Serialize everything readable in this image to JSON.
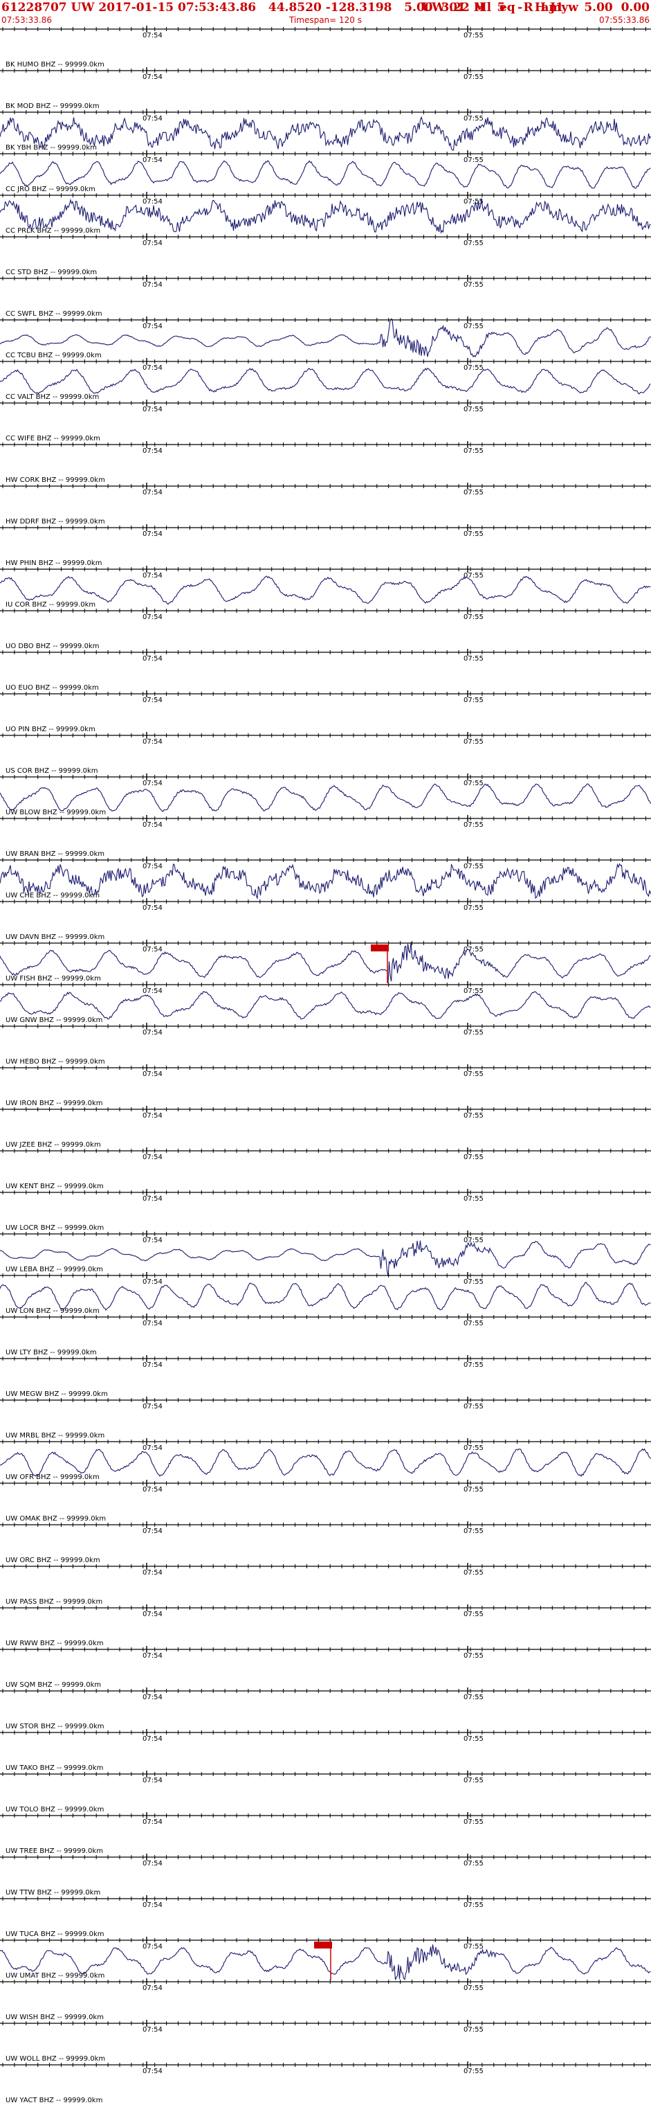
{
  "header": {
    "title": "61228707 UW 2017-01-15 07:53:43.86   44.8520 -128.3198   5.00  3.22 Ml  eq  R  amyw",
    "channel_info": "UW 01  H   5   -   H J1     5.00  0.00",
    "start_time": "07:53:33.86",
    "timespan": "Timespan= 120 s",
    "end_time": "07:55:33.86"
  },
  "time_marks": {
    "first": "07:54",
    "second": "07:55"
  },
  "colors": {
    "title": "#cc0000",
    "trace": "#1a1a6e",
    "axis": "#000000",
    "pick": "#cc0000"
  },
  "stations": [
    {
      "label": "BK HUMO BHZ -- 99999.0km",
      "trace": "none"
    },
    {
      "label": "BK MOD BHZ -- 99999.0km",
      "trace": "none"
    },
    {
      "label": "BK YBH BHZ -- 99999.0km",
      "trace": "noisy"
    },
    {
      "label": "CC JRO BHZ -- 99999.0km",
      "trace": "wave"
    },
    {
      "label": "CC PRLK BHZ -- 99999.0km",
      "trace": "noisy"
    },
    {
      "label": "CC STD BHZ -- 99999.0km",
      "trace": "none"
    },
    {
      "label": "CC SWFL BHZ -- 99999.0km",
      "trace": "none"
    },
    {
      "label": "CC TCBU BHZ -- 99999.0km",
      "trace": "burst"
    },
    {
      "label": "CC VALT BHZ -- 99999.0km",
      "trace": "wave"
    },
    {
      "label": "CC WIFE BHZ -- 99999.0km",
      "trace": "none"
    },
    {
      "label": "HW CORK BHZ -- 99999.0km",
      "trace": "none"
    },
    {
      "label": "HW DDRF BHZ -- 99999.0km",
      "trace": "none"
    },
    {
      "label": "HW PHIN BHZ -- 99999.0km",
      "trace": "none"
    },
    {
      "label": "IU COR BHZ -- 99999.0km",
      "trace": "wave"
    },
    {
      "label": "UO DBO BHZ -- 99999.0km",
      "trace": "none"
    },
    {
      "label": "UO EUO BHZ -- 99999.0km",
      "trace": "none"
    },
    {
      "label": "UO PIN BHZ -- 99999.0km",
      "trace": "none"
    },
    {
      "label": "US COR BHZ -- 99999.0km",
      "trace": "none"
    },
    {
      "label": "UW BLOW BHZ -- 99999.0km",
      "trace": "wave"
    },
    {
      "label": "UW BRAN BHZ -- 99999.0km",
      "trace": "none"
    },
    {
      "label": "UW CHE BHZ -- 99999.0km",
      "trace": "noisy"
    },
    {
      "label": "UW DAVN BHZ -- 99999.0km",
      "trace": "none"
    },
    {
      "label": "UW FISH BHZ -- 99999.0km",
      "trace": "pick"
    },
    {
      "label": "UW GNW BHZ -- 99999.0km",
      "trace": "wave"
    },
    {
      "label": "UW HEBO BHZ -- 99999.0km",
      "trace": "none"
    },
    {
      "label": "UW IRON BHZ -- 99999.0km",
      "trace": "none"
    },
    {
      "label": "UW JZEE BHZ -- 99999.0km",
      "trace": "none"
    },
    {
      "label": "UW KENT BHZ -- 99999.0km",
      "trace": "none"
    },
    {
      "label": "UW LOCR BHZ -- 99999.0km",
      "trace": "none"
    },
    {
      "label": "UW LEBA BHZ -- 99999.0km",
      "trace": "burst"
    },
    {
      "label": "UW LON BHZ -- 99999.0km",
      "trace": "wave"
    },
    {
      "label": "UW LTY BHZ -- 99999.0km",
      "trace": "none"
    },
    {
      "label": "UW MEGW BHZ -- 99999.0km",
      "trace": "none"
    },
    {
      "label": "UW MRBL BHZ -- 99999.0km",
      "trace": "none"
    },
    {
      "label": "UW OFR BHZ -- 99999.0km",
      "trace": "wave"
    },
    {
      "label": "UW OMAK BHZ -- 99999.0km",
      "trace": "none"
    },
    {
      "label": "UW ORC BHZ -- 99999.0km",
      "trace": "none"
    },
    {
      "label": "UW PASS BHZ -- 99999.0km",
      "trace": "none"
    },
    {
      "label": "UW RWW BHZ -- 99999.0km",
      "trace": "none"
    },
    {
      "label": "UW SQM BHZ -- 99999.0km",
      "trace": "none"
    },
    {
      "label": "UW STOR BHZ -- 99999.0km",
      "trace": "none"
    },
    {
      "label": "UW TAKO BHZ -- 99999.0km",
      "trace": "none"
    },
    {
      "label": "UW TOLO BHZ -- 99999.0km",
      "trace": "none"
    },
    {
      "label": "UW TREE BHZ -- 99999.0km",
      "trace": "none"
    },
    {
      "label": "UW TTW BHZ -- 99999.0km",
      "trace": "none"
    },
    {
      "label": "UW TUCA BHZ -- 99999.0km",
      "trace": "none"
    },
    {
      "label": "UW UMAT BHZ -- 99999.0km",
      "trace": "pick"
    },
    {
      "label": "UW WISH BHZ -- 99999.0km",
      "trace": "none"
    },
    {
      "label": "UW WOLL BHZ -- 99999.0km",
      "trace": "none"
    },
    {
      "label": "UW YACT BHZ -- 99999.0km",
      "trace": "none"
    }
  ]
}
